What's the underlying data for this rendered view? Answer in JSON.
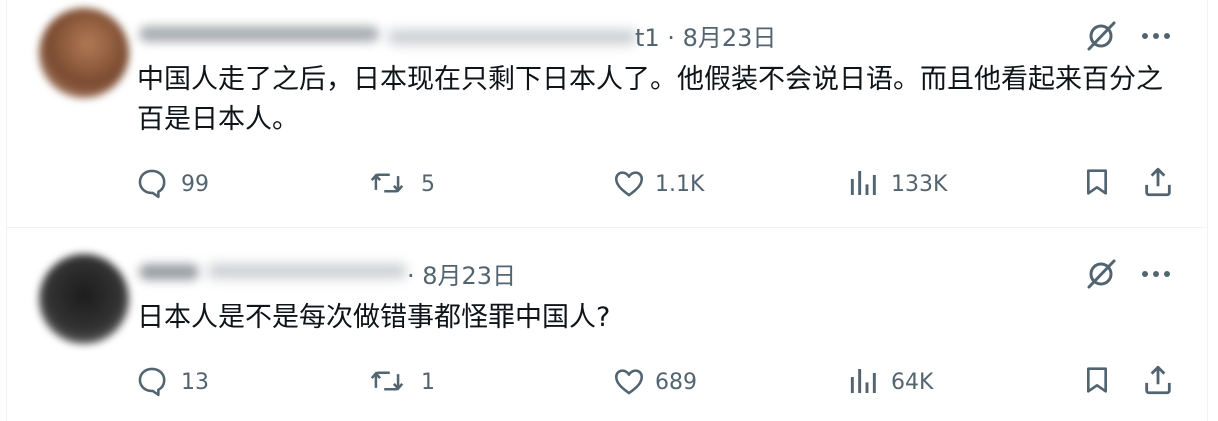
{
  "posts": [
    {
      "date_suffix": "t1 · 8月23日",
      "text": "中国人走了之后，日本现在只剩下日本人了。他假装不会说日语。而且他看起来百分之百是日本人。",
      "stats": {
        "replies": "99",
        "reposts": "5",
        "likes": "1.1K",
        "views": "133K"
      }
    },
    {
      "date_suffix": "· 8月23日",
      "text": "日本人是不是每次做错事都怪罪中国人?",
      "stats": {
        "replies": "13",
        "reposts": "1",
        "likes": "689",
        "views": "64K"
      }
    }
  ],
  "icons": [
    "grok-icon",
    "more-icon",
    "reply-icon",
    "repost-icon",
    "like-icon",
    "views-icon",
    "bookmark-icon",
    "share-icon"
  ],
  "colors": {
    "text": "#0f1419",
    "secondary": "#536471",
    "divider": "#eff3f4"
  }
}
